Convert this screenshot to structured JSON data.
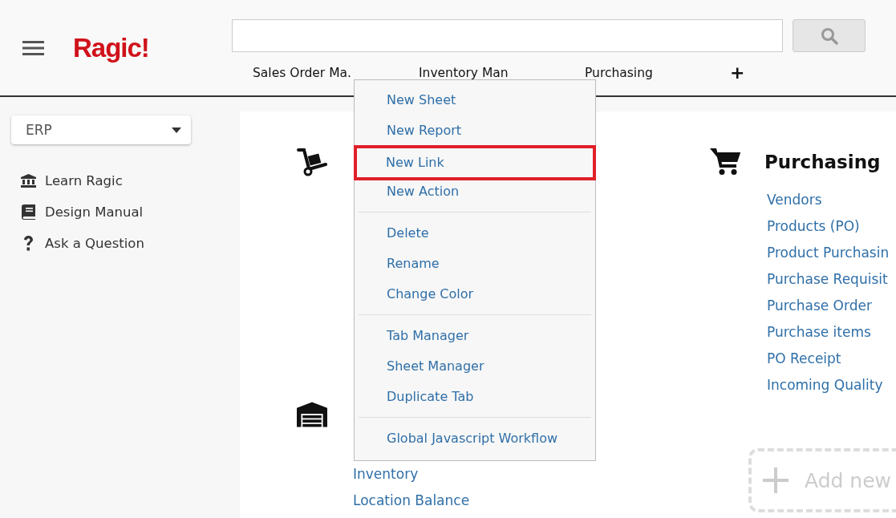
{
  "header": {
    "logo": "Ragic!"
  },
  "tabs": [
    {
      "label": "Sales Order Ma."
    },
    {
      "label": "Inventory Man"
    },
    {
      "label": "Purchasing"
    }
  ],
  "add_tab": "+",
  "sidebar": {
    "dropdown": "ERP",
    "links": [
      {
        "label": "Learn Ragic"
      },
      {
        "label": "Design Manual"
      },
      {
        "label": "Ask a Question"
      }
    ]
  },
  "purchasing": {
    "title": "Purchasing",
    "links": [
      "Vendors",
      "Products (PO)",
      "Product Purchasin",
      "Purchase Requisit",
      "Purchase Order",
      "Purchase items",
      "PO Receipt",
      "Incoming Quality"
    ]
  },
  "inventory": {
    "links": [
      "Inventory",
      "Location Balance"
    ]
  },
  "add_new": "Add new",
  "context_menu": {
    "groups": [
      [
        {
          "label": "New Sheet",
          "highlighted": false
        },
        {
          "label": "New Report",
          "highlighted": false
        },
        {
          "label": "New Link",
          "highlighted": true
        },
        {
          "label": "New Action",
          "highlighted": false
        }
      ],
      [
        {
          "label": "Delete",
          "highlighted": false
        },
        {
          "label": "Rename",
          "highlighted": false
        },
        {
          "label": "Change Color",
          "highlighted": false
        }
      ],
      [
        {
          "label": "Tab Manager",
          "highlighted": false
        },
        {
          "label": "Sheet Manager",
          "highlighted": false
        },
        {
          "label": "Duplicate Tab",
          "highlighted": false
        }
      ],
      [
        {
          "label": "Global Javascript Workflow",
          "highlighted": false
        }
      ]
    ]
  }
}
